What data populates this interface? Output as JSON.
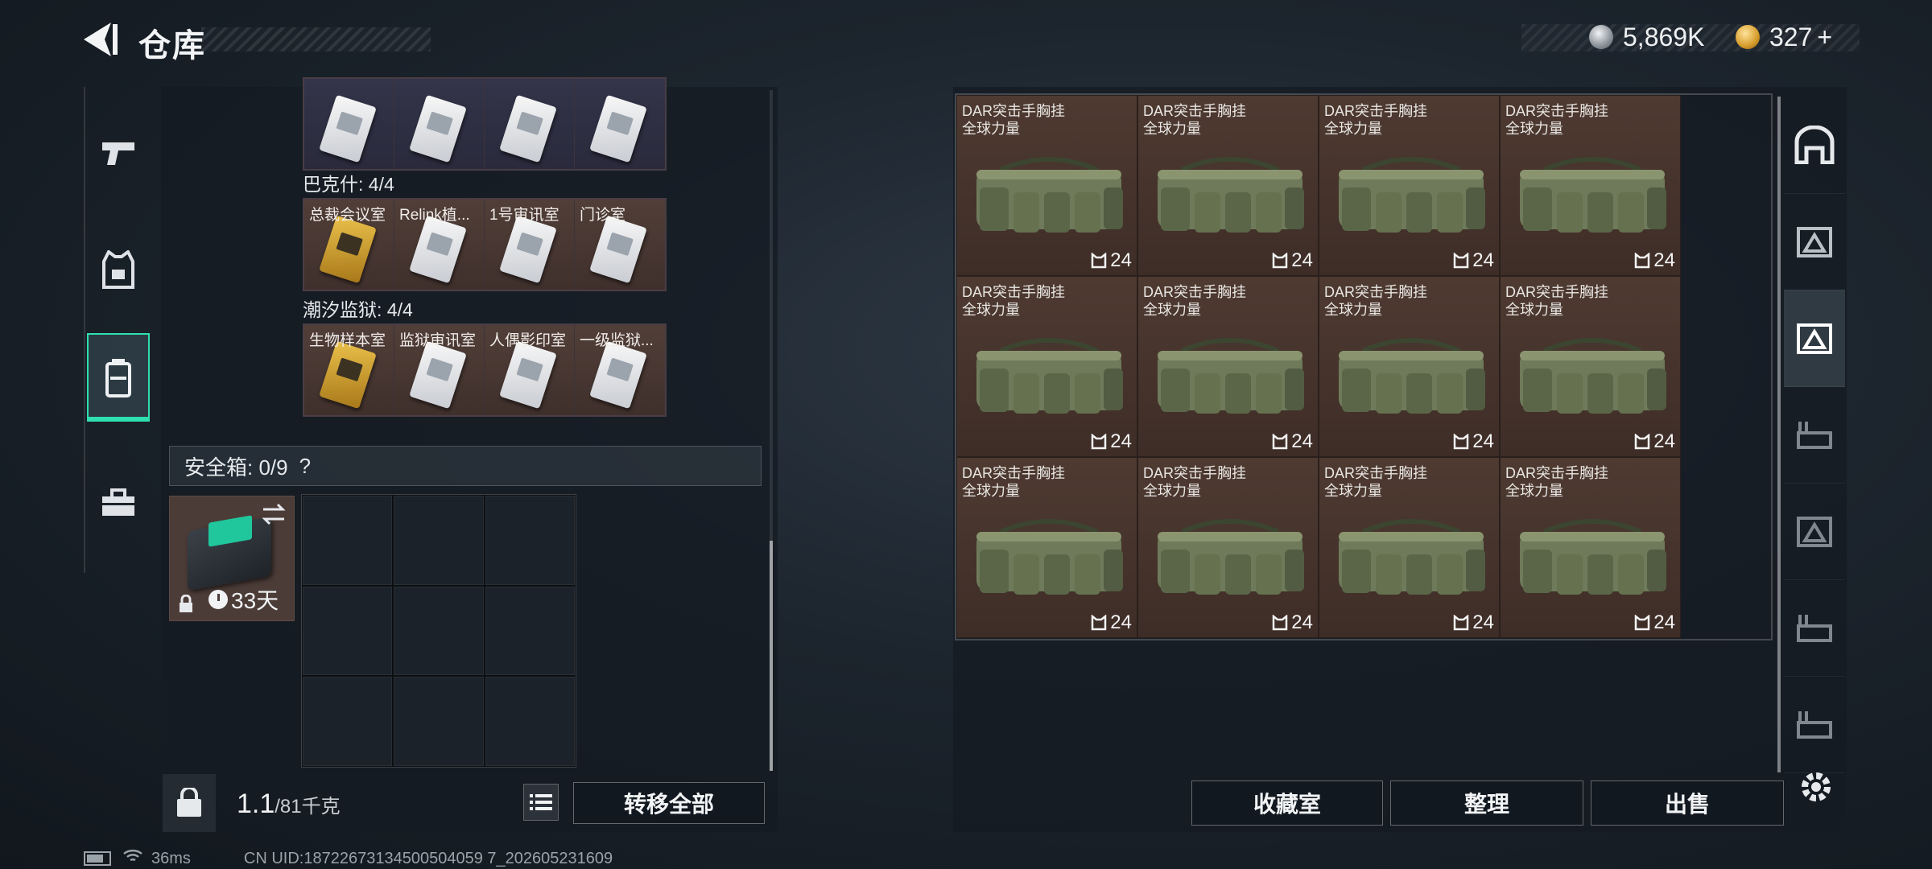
{
  "header": {
    "title": "仓库",
    "silver_amount": "5,869K",
    "gold_amount": "327",
    "gold_plus": "+"
  },
  "left_nav": {
    "items": [
      {
        "name": "weapon",
        "icon": "pistol-icon"
      },
      {
        "name": "armor",
        "icon": "vest-icon"
      },
      {
        "name": "backpack",
        "icon": "backpack-icon",
        "active": true
      },
      {
        "name": "toolbox",
        "icon": "toolbox-icon"
      }
    ]
  },
  "key_sections": [
    {
      "label": "",
      "keys": [
        {
          "text": "",
          "style": "blank"
        },
        {
          "text": "",
          "style": "blank"
        },
        {
          "text": "",
          "style": "blank"
        },
        {
          "text": "",
          "style": "blank"
        }
      ]
    },
    {
      "label": "巴克什: 4/4",
      "keys": [
        {
          "text": "总裁会议室",
          "style": "gold"
        },
        {
          "text": "Relink植...",
          "style": "white"
        },
        {
          "text": "1号审讯室",
          "style": "white"
        },
        {
          "text": "门诊室",
          "style": "white"
        }
      ]
    },
    {
      "label": "潮汐监狱: 4/4",
      "keys": [
        {
          "text": "生物样本室",
          "style": "gold"
        },
        {
          "text": "监狱审讯室",
          "style": "white"
        },
        {
          "text": "人偶影印室",
          "style": "white"
        },
        {
          "text": "一级监狱...",
          "style": "white"
        }
      ]
    }
  ],
  "safe_box": {
    "label": "安全箱: 0/9",
    "help": "?",
    "timer": "33天"
  },
  "bottom_left": {
    "weight_current": "1.1",
    "weight_max": "/81千克",
    "transfer_all": "转移全部"
  },
  "bottom_right": {
    "collection": "收藏室",
    "organize": "整理",
    "sell": "出售"
  },
  "items": [
    {
      "line1": "DAR突击手胸挂",
      "line2": "全球力量",
      "count": "24"
    },
    {
      "line1": "DAR突击手胸挂",
      "line2": "全球力量",
      "count": "24"
    },
    {
      "line1": "DAR突击手胸挂",
      "line2": "全球力量",
      "count": "24"
    },
    {
      "line1": "DAR突击手胸挂",
      "line2": "全球力量",
      "count": "24"
    },
    {
      "line1": "DAR突击手胸挂",
      "line2": "全球力量",
      "count": "24"
    },
    {
      "line1": "DAR突击手胸挂",
      "line2": "全球力量",
      "count": "24"
    },
    {
      "line1": "DAR突击手胸挂",
      "line2": "全球力量",
      "count": "24"
    },
    {
      "line1": "DAR突击手胸挂",
      "line2": "全球力量",
      "count": "24"
    },
    {
      "line1": "DAR突击手胸挂",
      "line2": "全球力量",
      "count": "24"
    },
    {
      "line1": "DAR突击手胸挂",
      "line2": "全球力量",
      "count": "24"
    },
    {
      "line1": "DAR突击手胸挂",
      "line2": "全球力量",
      "count": "24"
    },
    {
      "line1": "DAR突击手胸挂",
      "line2": "全球力量",
      "count": "24"
    }
  ],
  "status_bar": {
    "ping": "36ms",
    "uid": "CN UID:18722673134500504059 7_202605231609"
  },
  "colors": {
    "accent": "#2ee0b0",
    "item_bg": "#4e3a31",
    "gold_key": "#d4a02e"
  }
}
